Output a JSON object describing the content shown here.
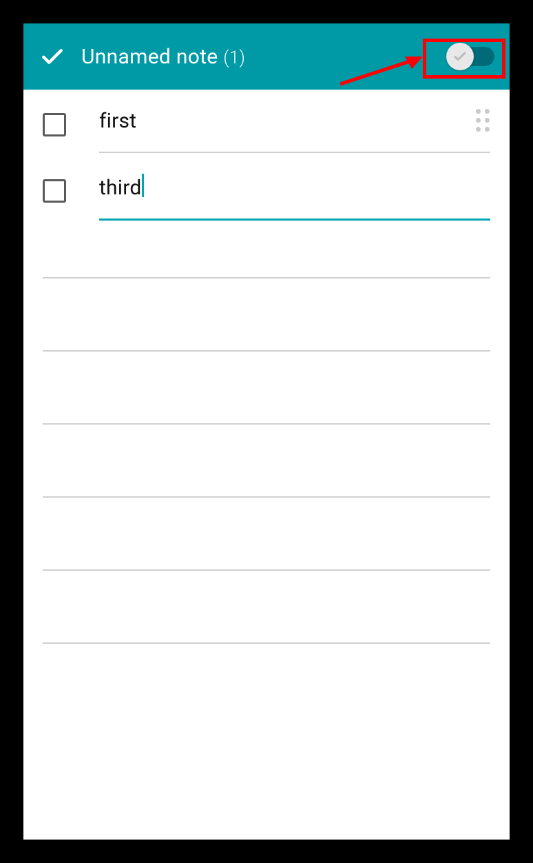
{
  "header": {
    "title": "Unnamed note",
    "count_label": "(1)",
    "checklist_toggle_on": false
  },
  "items": [
    {
      "text": "first",
      "checked": false,
      "active": false,
      "has_drag": true
    },
    {
      "text": "third",
      "checked": false,
      "active": true,
      "has_drag": false
    }
  ],
  "empty_line_count": 6,
  "annotation": {
    "highlight_toggle": true,
    "arrow_to_toggle": true
  },
  "colors": {
    "accent": "#009aa6",
    "underline_active": "#00a7b3",
    "annotation": "#ff0000"
  }
}
